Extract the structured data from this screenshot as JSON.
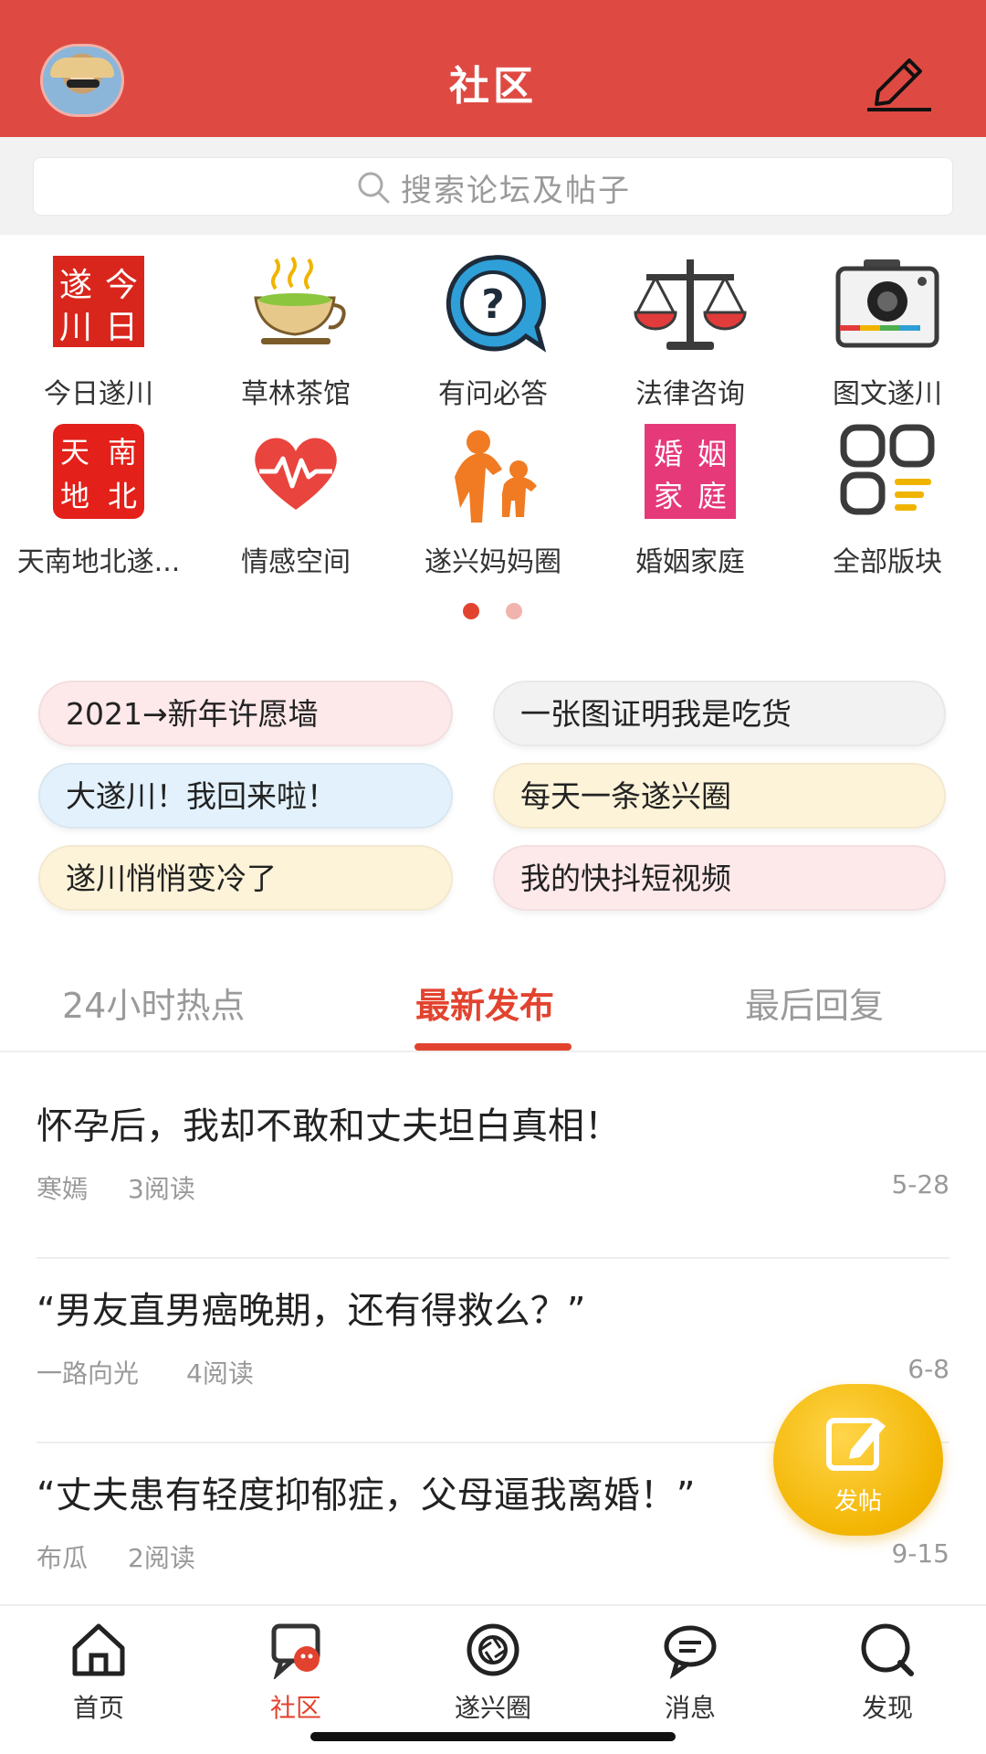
{
  "header": {
    "title": "社区",
    "avatar_icon": "user-avatar",
    "edit_icon": "pen-edit-icon"
  },
  "search": {
    "placeholder": "搜索论坛及帖子"
  },
  "categories": [
    {
      "label": "今日遂川",
      "icon": "today-suichuan-logo"
    },
    {
      "label": "草林茶馆",
      "icon": "tea-cup-icon"
    },
    {
      "label": "有问必答",
      "icon": "question-bubble-icon"
    },
    {
      "label": "法律咨询",
      "icon": "scales-icon"
    },
    {
      "label": "图文遂川",
      "icon": "camera-icon"
    },
    {
      "label": "天南地北遂...",
      "icon": "tiannan-dibei-logo"
    },
    {
      "label": "情感空间",
      "icon": "heartbeat-icon"
    },
    {
      "label": "遂兴妈妈圈",
      "icon": "mother-child-icon"
    },
    {
      "label": "婚姻家庭",
      "icon": "marriage-family-logo"
    },
    {
      "label": "全部版块",
      "icon": "all-sections-icon"
    }
  ],
  "pager": {
    "active_index": 0,
    "count": 2,
    "active_color": "#e2432f",
    "inactive_color": "#f1b3ad"
  },
  "topics": [
    {
      "label": "2021→新年许愿墙",
      "color": "#fde8ea"
    },
    {
      "label": "一张图证明我是吃货",
      "color": "#f2f2f2"
    },
    {
      "label": "大遂川！我回来啦！",
      "color": "#e2f1fb"
    },
    {
      "label": "每天一条遂兴圈",
      "color": "#fdf3d9"
    },
    {
      "label": "遂川悄悄变冷了",
      "color": "#fdf3d9"
    },
    {
      "label": "我的快抖短视频",
      "color": "#fde8ea"
    }
  ],
  "tabs": [
    {
      "label": "24小时热点",
      "active": false
    },
    {
      "label": "最新发布",
      "active": true
    },
    {
      "label": "最后回复",
      "active": false
    }
  ],
  "posts": [
    {
      "title": "怀孕后，我却不敢和丈夫坦白真相！",
      "author": "寒嫣",
      "reads": "3阅读",
      "date": "5-28"
    },
    {
      "title": "“男友直男癌晚期，还有得救么？”",
      "author": "一路向光",
      "reads": "4阅读",
      "date": "6-8"
    },
    {
      "title": "“丈夫患有轻度抑郁症，父母逼我离婚！”",
      "author": "布瓜",
      "reads": "2阅读",
      "date": "9-15"
    }
  ],
  "fab": {
    "label": "发帖",
    "icon": "compose-icon"
  },
  "bottom_nav": [
    {
      "label": "首页",
      "icon": "home-icon",
      "active": false
    },
    {
      "label": "社区",
      "icon": "community-chat-icon",
      "active": true
    },
    {
      "label": "遂兴圈",
      "icon": "aperture-icon",
      "active": false
    },
    {
      "label": "消息",
      "icon": "message-bubble-icon",
      "active": false
    },
    {
      "label": "发现",
      "icon": "discover-search-icon",
      "active": false
    }
  ],
  "colors": {
    "brand_red": "#de4a42",
    "accent": "#e2432f",
    "fab_yellow": "#f2b400"
  }
}
